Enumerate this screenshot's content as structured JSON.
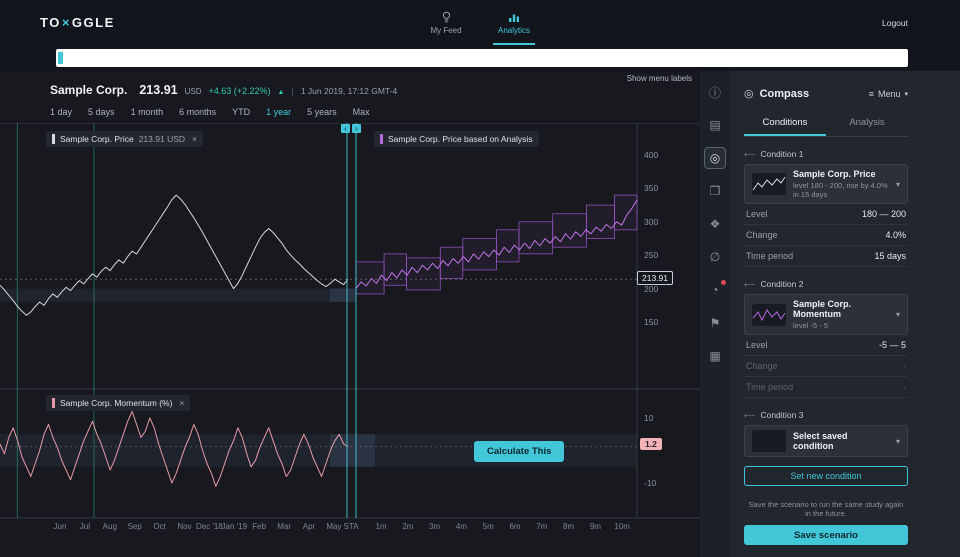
{
  "icons": {
    "menu": "≡",
    "chevron_down": "▾",
    "close": "×",
    "compass": "◎",
    "condition_arrow": "⟵",
    "up_arrow": "▲",
    "handle_left": "‹",
    "handle_right": "›",
    "separator": "|"
  },
  "topbar": {
    "logo_prefix": "TO",
    "logo_glyph": "×",
    "logo_suffix": "GGLE",
    "nav": [
      {
        "label": "My Feed"
      },
      {
        "label": "Analytics"
      }
    ],
    "logout": "Logout"
  },
  "search": {
    "value": ""
  },
  "stock": {
    "name": "Sample Corp.",
    "price": "213.91",
    "currency": "USD",
    "change": "+4.63 (+2.22%)",
    "timestamp": "1 Jun 2019, 17:12 GMT-4"
  },
  "ranges": {
    "items": [
      "1 day",
      "5 days",
      "1 month",
      "6 months",
      "YTD",
      "1 year",
      "5 years",
      "Max"
    ],
    "active": "1 year"
  },
  "show_menu_labels": "Show menu labels",
  "charts": {
    "price": {
      "legend": "Sample Corp. Price",
      "legend_value": "213.91 USD",
      "axis": [
        400,
        350,
        300,
        250,
        200,
        150
      ],
      "current_tag": "213.91"
    },
    "forecast": {
      "legend": "Sample Corp. Price based on Analysis"
    },
    "momentum": {
      "legend": "Sample Corp. Momentum (%)",
      "axis": [
        10,
        -10
      ],
      "current_tag": "1.2"
    },
    "calculate_button": "Calculate This",
    "x_labels_history": [
      "Jun",
      "Jul",
      "Aug",
      "Sep",
      "Oct",
      "Nov",
      "Dec '18",
      "Jan '19",
      "Feb",
      "Mar",
      "Apr",
      "May"
    ],
    "x_labels_forecast": [
      "STA",
      "1m",
      "2m",
      "3m",
      "4m",
      "5m",
      "6m",
      "7m",
      "8m",
      "9m",
      "10m"
    ]
  },
  "chart_data": {
    "type": "line",
    "current_price": 213.91,
    "current_momentum": 1.2,
    "bands": {
      "price": [
        180,
        200
      ],
      "momentum": [
        -5,
        5
      ]
    },
    "markers": [
      0.05,
      0.27
    ],
    "history": [
      205,
      198,
      190,
      182,
      173,
      166,
      160,
      165,
      173,
      180,
      175,
      185,
      192,
      187,
      195,
      202,
      197,
      205,
      212,
      207,
      215,
      222,
      217,
      226,
      232,
      227,
      236,
      243,
      238,
      248,
      256,
      252,
      262,
      272,
      282,
      292,
      302,
      312,
      322,
      333,
      340,
      334,
      326,
      316,
      306,
      295,
      284,
      272,
      260,
      248,
      236,
      224,
      212,
      200,
      208,
      220,
      234,
      248,
      262,
      275,
      284,
      290,
      284,
      276,
      268,
      258,
      250,
      243,
      237,
      230,
      224,
      218,
      212,
      207,
      203,
      208,
      214,
      210,
      206,
      213.91
    ],
    "momentum": [
      2,
      -1,
      4,
      7,
      3,
      -2,
      -5,
      -8,
      -4,
      0,
      5,
      8,
      4,
      1,
      -3,
      -6,
      -9,
      -5,
      -1,
      3,
      6,
      9,
      5,
      2,
      -2,
      -6,
      -3,
      1,
      5,
      9,
      12,
      8,
      4,
      6,
      10,
      7,
      2,
      -2,
      -6,
      -10,
      -7,
      -3,
      1,
      4,
      8,
      5,
      0,
      -4,
      -7,
      -11,
      -8,
      -4,
      0,
      3,
      7,
      4,
      -1,
      -5,
      -3,
      1,
      4,
      7,
      3,
      -1,
      -4,
      -8,
      -6,
      -2,
      2,
      5,
      2,
      -2,
      -5,
      -8,
      -4,
      0,
      3,
      5,
      2,
      1.2
    ],
    "forecast": [
      200,
      210,
      204,
      215,
      208,
      220,
      212,
      224,
      216,
      228,
      220,
      232,
      224,
      235,
      228,
      238,
      230,
      242,
      234,
      245,
      238,
      248,
      240,
      252,
      244,
      255,
      248,
      258,
      250,
      262,
      254,
      265,
      258,
      268,
      260,
      272,
      264,
      275,
      268,
      278,
      270,
      282,
      274,
      285,
      278,
      288,
      282,
      292,
      286,
      296,
      290,
      300,
      295,
      310,
      320,
      333
    ],
    "forecast_boxes": [
      [
        0.0,
        0.1,
        192,
        240
      ],
      [
        0.1,
        0.18,
        205,
        252
      ],
      [
        0.18,
        0.3,
        198,
        246
      ],
      [
        0.3,
        0.38,
        215,
        262
      ],
      [
        0.38,
        0.5,
        228,
        275
      ],
      [
        0.5,
        0.58,
        240,
        288
      ],
      [
        0.58,
        0.7,
        252,
        300
      ],
      [
        0.7,
        0.82,
        262,
        312
      ],
      [
        0.82,
        0.92,
        275,
        325
      ],
      [
        0.92,
        1.0,
        288,
        340
      ]
    ]
  },
  "icon_rail": [
    {
      "name": "info-icon",
      "glyph": "ⓘ"
    },
    {
      "name": "clipboard-icon",
      "glyph": "▤"
    },
    {
      "name": "compass-icon",
      "glyph": "◎",
      "active": true
    },
    {
      "name": "layers-icon",
      "glyph": "❐"
    },
    {
      "name": "nodes-icon",
      "glyph": "❖"
    },
    {
      "name": "eye-off-icon",
      "glyph": "∅"
    },
    {
      "name": "alerts-icon",
      "glyph": "◔",
      "badge": true
    },
    {
      "name": "pin-icon",
      "glyph": "⚑"
    },
    {
      "name": "archive-icon",
      "glyph": "▦"
    }
  ],
  "sidebar": {
    "title": "Compass",
    "menu_label": "Menu",
    "tabs": [
      {
        "label": "Conditions"
      },
      {
        "label": "Analysis"
      }
    ],
    "conditions": [
      {
        "label": "Condition 1",
        "title": "Sample Corp. Price",
        "subtitle": "level 180 - 200, rise by 4.0% in 15 days",
        "rows": [
          {
            "label": "Level",
            "value": "180  —  200"
          },
          {
            "label": "Change",
            "value": "4.0%"
          },
          {
            "label": "Time period",
            "value": "15 days"
          }
        ]
      },
      {
        "label": "Condition 2",
        "title": "Sample Corp. Momentum",
        "subtitle": "level -5 - 5",
        "rows": [
          {
            "label": "Level",
            "value": "-5  —  5"
          },
          {
            "label": "Change",
            "value": "-"
          },
          {
            "label": "Time period",
            "value": "-"
          }
        ]
      },
      {
        "label": "Condition 3",
        "title": "Select saved condition"
      }
    ],
    "set_new_condition": "Set new condition",
    "save_note": "Save the scenario to run the same study again in the future.",
    "save_button": "Save scenario"
  }
}
